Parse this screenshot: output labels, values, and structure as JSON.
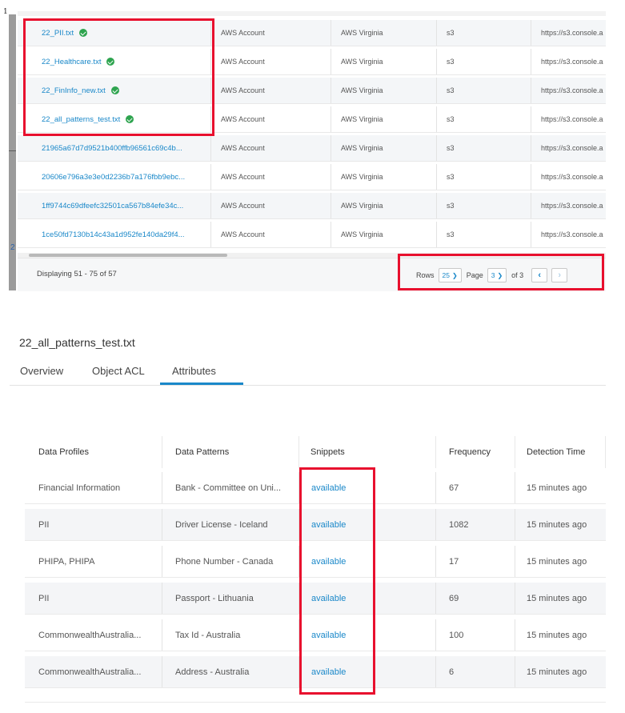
{
  "corner_number": "1",
  "left_number": "2",
  "top_table": {
    "rows": [
      {
        "name": "22_PII.txt",
        "verified": true,
        "account": "AWS Account",
        "region": "AWS Virginia",
        "service": "s3",
        "url": "https://s3.console.a"
      },
      {
        "name": "22_Healthcare.txt",
        "verified": true,
        "account": "AWS Account",
        "region": "AWS Virginia",
        "service": "s3",
        "url": "https://s3.console.a"
      },
      {
        "name": "22_FinInfo_new.txt",
        "verified": true,
        "account": "AWS Account",
        "region": "AWS Virginia",
        "service": "s3",
        "url": "https://s3.console.a"
      },
      {
        "name": "22_all_patterns_test.txt",
        "verified": true,
        "account": "AWS Account",
        "region": "AWS Virginia",
        "service": "s3",
        "url": "https://s3.console.a"
      },
      {
        "name": "21965a67d7d9521b400ffb96561c69c4b...",
        "verified": false,
        "account": "AWS Account",
        "region": "AWS Virginia",
        "service": "s3",
        "url": "https://s3.console.a"
      },
      {
        "name": "20606e796a3e3e0d2236b7a176fbb9ebc...",
        "verified": false,
        "account": "AWS Account",
        "region": "AWS Virginia",
        "service": "s3",
        "url": "https://s3.console.a"
      },
      {
        "name": "1ff9744c69dfeefc32501ca567b84efe34c...",
        "verified": false,
        "account": "AWS Account",
        "region": "AWS Virginia",
        "service": "s3",
        "url": "https://s3.console.a"
      },
      {
        "name": "1ce50fd7130b14c43a1d952fe140da29f4...",
        "verified": false,
        "account": "AWS Account",
        "region": "AWS Virginia",
        "service": "s3",
        "url": "https://s3.console.a"
      }
    ]
  },
  "footer": {
    "displaying": "Displaying 51 - 75 of 57",
    "rows_label": "Rows",
    "rows_value": "25",
    "page_label": "Page",
    "page_value": "3",
    "of_label": "of 3",
    "prev_icon": "chevron-left-icon",
    "next_icon": "chevron-right-icon"
  },
  "detail": {
    "title": "22_all_patterns_test.txt",
    "tabs": [
      "Overview",
      "Object ACL",
      "Attributes"
    ],
    "active_tab": "Attributes"
  },
  "attributes_table": {
    "headers": [
      "Data Profiles",
      "Data Patterns",
      "Snippets",
      "Frequency",
      "Detection Time"
    ],
    "rows": [
      {
        "profile": "Financial Information",
        "pattern": "Bank - Committee on Uni...",
        "snippet": "available",
        "frequency": "67",
        "time": "15 minutes ago"
      },
      {
        "profile": "PII",
        "pattern": "Driver License - Iceland",
        "snippet": "available",
        "frequency": "1082",
        "time": "15 minutes ago"
      },
      {
        "profile": "PHIPA, PHIPA",
        "pattern": "Phone Number - Canada",
        "snippet": "available",
        "frequency": "17",
        "time": "15 minutes ago"
      },
      {
        "profile": "PII",
        "pattern": "Passport - Lithuania",
        "snippet": "available",
        "frequency": "69",
        "time": "15 minutes ago"
      },
      {
        "profile": "CommonwealthAustralia...",
        "pattern": "Tax Id - Australia",
        "snippet": "available",
        "frequency": "100",
        "time": "15 minutes ago"
      },
      {
        "profile": "CommonwealthAustralia...",
        "pattern": "Address - Australia",
        "snippet": "available",
        "frequency": "6",
        "time": "15 minutes ago"
      }
    ]
  },
  "colors": {
    "link": "#1a88c9",
    "highlight": "#e8102e",
    "verified": "#2ea44f"
  }
}
